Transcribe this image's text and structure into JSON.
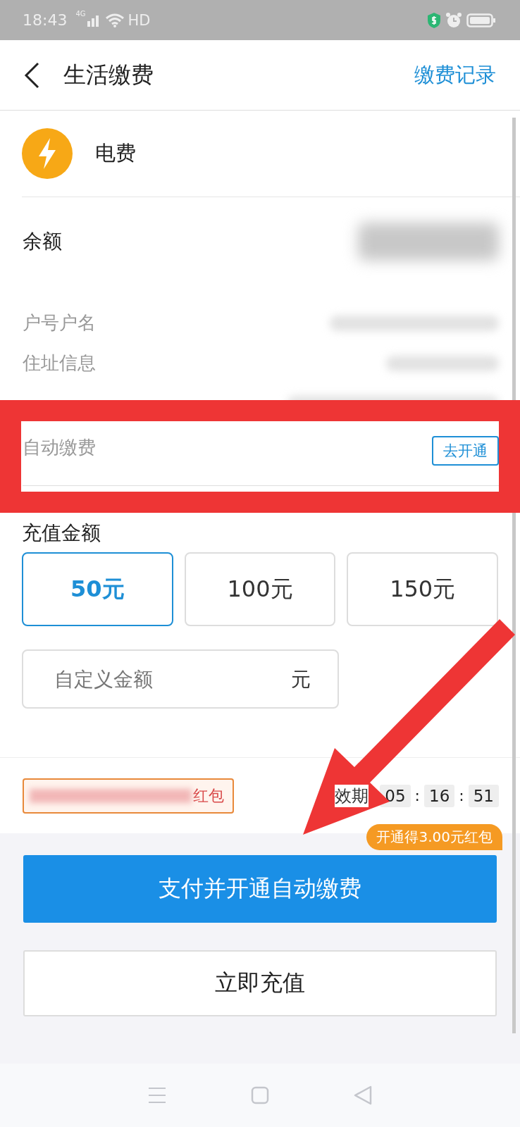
{
  "status_bar": {
    "time": "18:43",
    "network": "4G",
    "hd": "HD"
  },
  "header": {
    "title": "生活缴费",
    "action": "缴费记录"
  },
  "biller": {
    "name": "电费"
  },
  "details": [
    {
      "label": "余额",
      "kind": "balance"
    },
    {
      "label": "户号户名",
      "kind": "info"
    },
    {
      "label": "住址信息",
      "kind": "info"
    }
  ],
  "auto_pay": {
    "label": "自动缴费",
    "button": "去开通"
  },
  "amount": {
    "title": "充值金额",
    "options": [
      {
        "label": "50元",
        "selected": true
      },
      {
        "label": "100元",
        "selected": false
      },
      {
        "label": "150元",
        "selected": false
      }
    ],
    "custom": {
      "placeholder": "自定义金额",
      "unit": "元"
    }
  },
  "promo": {
    "text": "红包",
    "expiry_label": "效期",
    "countdown": [
      "05",
      "16",
      "51"
    ],
    "separators": [
      ":",
      ":"
    ]
  },
  "buttons": {
    "primary": "支付并开通自动缴费",
    "badge": "开通得3.00元红包",
    "secondary": "立即充值"
  }
}
